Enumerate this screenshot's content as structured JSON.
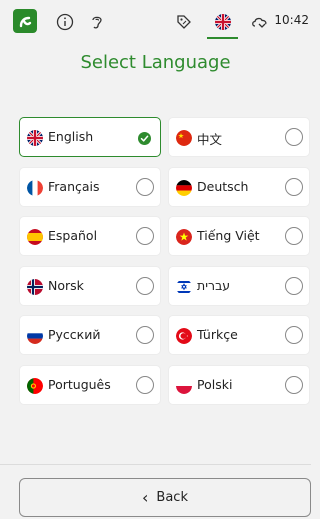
{
  "status_bar": {
    "time": "10:42",
    "icons": [
      "app-logo-icon",
      "info-icon",
      "hearing-icon",
      "tag-icon",
      "flag-uk-icon",
      "cloud-icon"
    ]
  },
  "title": "Select Language",
  "languages": [
    {
      "name": "English",
      "flag": "uk",
      "selected": true
    },
    {
      "name": "中文",
      "flag": "cn",
      "selected": false
    },
    {
      "name": "Français",
      "flag": "fr",
      "selected": false
    },
    {
      "name": "Deutsch",
      "flag": "de",
      "selected": false
    },
    {
      "name": "Español",
      "flag": "es",
      "selected": false
    },
    {
      "name": "Tiếng Việt",
      "flag": "vn",
      "selected": false
    },
    {
      "name": "Norsk",
      "flag": "no",
      "selected": false
    },
    {
      "name": "עברית",
      "flag": "il",
      "selected": false
    },
    {
      "name": "Русский",
      "flag": "ru",
      "selected": false
    },
    {
      "name": "Türkçe",
      "flag": "tr",
      "selected": false
    },
    {
      "name": "Português",
      "flag": "pt",
      "selected": false
    },
    {
      "name": "Polski",
      "flag": "pl",
      "selected": false
    }
  ],
  "back_button": {
    "label": "Back"
  },
  "colors": {
    "accent": "#2e8b2e"
  }
}
